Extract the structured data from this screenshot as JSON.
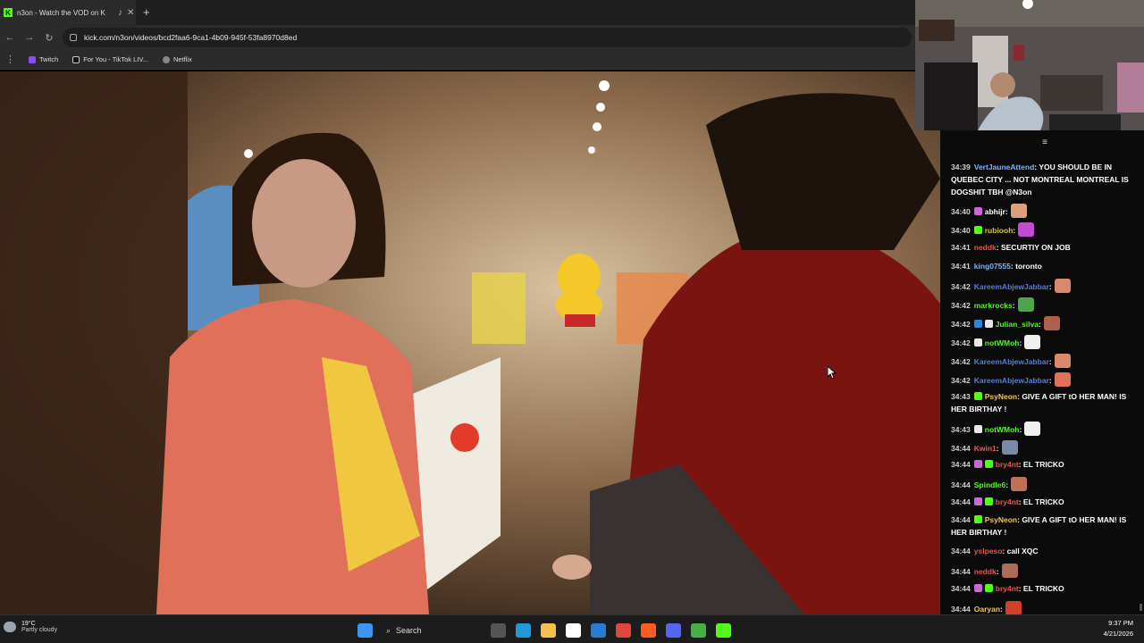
{
  "browser": {
    "tab_title": "n3on - Watch the VOD on K",
    "favicon_letter": "K",
    "url": "kick.com/n3on/videos/bcd2faa6-9ca1-4b09-945f-53fa8970d8ed",
    "bookmarks": [
      {
        "label": "Twitch",
        "color": "#9146ff"
      },
      {
        "label": "For You - TikTok LIV...",
        "color": "#111111"
      },
      {
        "label": "Netflix",
        "color": "#888888"
      }
    ]
  },
  "chat": {
    "messages": [
      {
        "time": "34:39",
        "user": "VertJauneAttend",
        "color": "#7fb3ff",
        "badges": [],
        "text": ": YOU SHOULD BE IN QUEBEC CITY ... NOT MONTREAL MONTREAL IS DOGSHIT TBH @N3on",
        "emote": ""
      },
      {
        "time": "34:40",
        "user": "abhijr",
        "color": "#ffffff",
        "badges": [
          "#c86ad6"
        ],
        "text": ":",
        "emote": "#d9a07a"
      },
      {
        "time": "34:40",
        "user": "rubiooh",
        "color": "#e0c23a",
        "badges": [
          "#53fc18"
        ],
        "text": ":",
        "emote": "#c34bd6"
      },
      {
        "time": "34:41",
        "user": "neddk",
        "color": "#e8544e",
        "badges": [],
        "text": ": SECURTIY ON JOB",
        "emote": ""
      },
      {
        "time": "34:41",
        "user": "king07555",
        "color": "#7fb3ff",
        "badges": [],
        "text": ": toronto",
        "emote": ""
      },
      {
        "time": "34:42",
        "user": "KareemAbjewJabbar",
        "color": "#5a7bd8",
        "badges": [],
        "text": ":",
        "emote": "#d98a6a"
      },
      {
        "time": "34:42",
        "user": "markrocks",
        "color": "#53fc18",
        "badges": [],
        "text": ":",
        "emote": "#4fa34a"
      },
      {
        "time": "34:42",
        "user": "Julian_silva",
        "color": "#53fc18",
        "badges": [
          "#2f86d6",
          "#e8e8e8"
        ],
        "text": ":",
        "emote": "#b0604a"
      },
      {
        "time": "34:42",
        "user": "notWMoh",
        "color": "#53fc18",
        "badges": [
          "#e8e8e8"
        ],
        "text": ":",
        "emote": "#f0f0f0"
      },
      {
        "time": "34:42",
        "user": "KareemAbjewJabbar",
        "color": "#5a7bd8",
        "badges": [],
        "text": ":",
        "emote": "#d98a6a"
      },
      {
        "time": "34:42",
        "user": "KareemAbjewJabbar",
        "color": "#5a7bd8",
        "badges": [],
        "text": ":",
        "emote": "#e2705a"
      },
      {
        "time": "34:43",
        "user": "PsyNeon",
        "color": "#f0c84a",
        "badges": [
          "#53fc18"
        ],
        "text": ": GIVE A GIFT tO HER MAN! IS HER BIRTHAY !",
        "emote": ""
      },
      {
        "time": "34:43",
        "user": "notWMoh",
        "color": "#53fc18",
        "badges": [
          "#e8e8e8"
        ],
        "text": ":",
        "emote": "#f0f0f0"
      },
      {
        "time": "34:44",
        "user": "Kwin1",
        "color": "#e25d5d",
        "badges": [],
        "text": ":",
        "emote": "#7a8aa8"
      },
      {
        "time": "34:44",
        "user": "bry4nt",
        "color": "#e8544e",
        "badges": [
          "#c86ad6",
          "#53fc18"
        ],
        "text": ": EL TRICKO",
        "emote": ""
      },
      {
        "time": "34:44",
        "user": "Spindle6",
        "color": "#53fc18",
        "badges": [],
        "text": ":",
        "emote": "#c0705a"
      },
      {
        "time": "34:44",
        "user": "bry4nt",
        "color": "#e8544e",
        "badges": [
          "#c86ad6",
          "#53fc18"
        ],
        "text": ": EL TRICKO",
        "emote": ""
      },
      {
        "time": "34:44",
        "user": "PsyNeon",
        "color": "#f0c84a",
        "badges": [
          "#53fc18"
        ],
        "text": ": GIVE A GIFT tO HER MAN! IS HER BIRTHAY !",
        "emote": ""
      },
      {
        "time": "34:44",
        "user": "yslpeso",
        "color": "#e8544e",
        "badges": [],
        "text": ": call XQC",
        "emote": ""
      },
      {
        "time": "34:44",
        "user": "neddk",
        "color": "#e8544e",
        "badges": [],
        "text": ":",
        "emote": "#b06a5a"
      },
      {
        "time": "34:44",
        "user": "bry4nt",
        "color": "#e8544e",
        "badges": [
          "#c86ad6",
          "#53fc18"
        ],
        "text": ": EL TRICKO",
        "emote": ""
      },
      {
        "time": "34:44",
        "user": "Oaryan",
        "color": "#f0c84a",
        "badges": [],
        "text": ":",
        "emote": "#d2402a"
      }
    ]
  },
  "taskbar": {
    "temperature": "19°C",
    "condition": "Partly cloudy",
    "search_label": "Search",
    "time": "9:37 PM",
    "date": "4/21/2026",
    "icons": [
      {
        "name": "windows-start-icon",
        "color": "#3a96f0"
      },
      {
        "name": "task-view-icon",
        "color": "#555555"
      },
      {
        "name": "edge-icon",
        "color": "#1f9ad6"
      },
      {
        "name": "file-explorer-icon",
        "color": "#f2c14e"
      },
      {
        "name": "store-icon",
        "color": "#ffffff"
      },
      {
        "name": "mail-icon",
        "color": "#2a7ad6"
      },
      {
        "name": "chrome-icon",
        "color": "#e0463a"
      },
      {
        "name": "soundcloud-icon",
        "color": "#ff5a1f"
      },
      {
        "name": "discord-icon",
        "color": "#5865f2"
      },
      {
        "name": "xbox-icon",
        "color": "#46b046"
      },
      {
        "name": "kick-icon",
        "color": "#53fc18"
      }
    ]
  }
}
